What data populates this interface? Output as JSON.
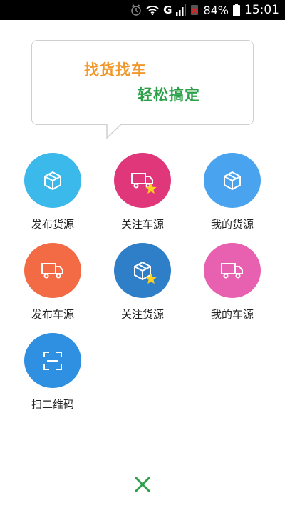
{
  "status_bar": {
    "carrier": "G",
    "battery_percent": "84%",
    "time": "15:01"
  },
  "banner": {
    "line1": "找货找车",
    "line2": "轻松搞定",
    "line1_color": "#f2982a",
    "line2_color": "#2ca14a"
  },
  "grid": {
    "items": [
      {
        "label": "发布货源",
        "icon": "box-icon",
        "color": "#3bb9ea"
      },
      {
        "label": "关注车源",
        "icon": "truck-star-icon",
        "color": "#e0367a"
      },
      {
        "label": "我的货源",
        "icon": "box-icon",
        "color": "#4aa3ee"
      },
      {
        "label": "发布车源",
        "icon": "truck-icon",
        "color": "#f26b45"
      },
      {
        "label": "关注货源",
        "icon": "box-star-icon",
        "color": "#2f7fc8"
      },
      {
        "label": "我的车源",
        "icon": "truck-icon",
        "color": "#e860b0"
      },
      {
        "label": "扫二维码",
        "icon": "scan-icon",
        "color": "#2f8fe0"
      }
    ]
  },
  "close_button": {
    "icon": "close-icon",
    "color": "#2ca14a"
  }
}
